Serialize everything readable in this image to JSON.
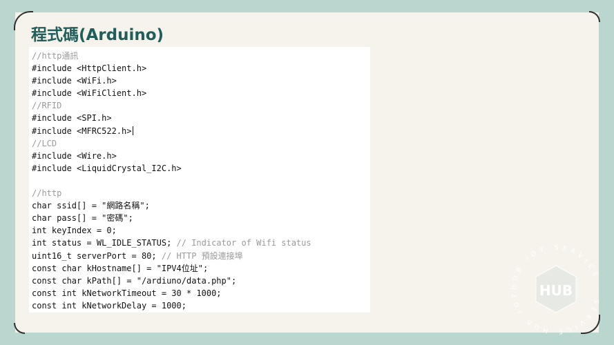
{
  "slide": {
    "title": "程式碼(Arduino)",
    "code": {
      "l1": "//http通訊",
      "l2": "#include <HttpClient.h>",
      "l3": "#include <WiFi.h>",
      "l4": "#include <WiFiClient.h>",
      "l5": "//RFID",
      "l6": "#include <SPI.h>",
      "l7": "#include <MFRC522.h>",
      "l8": "//LCD",
      "l9": "#include <Wire.h>",
      "l10": "#include <LiquidCrystal_I2C.h>",
      "l11": "",
      "l12": "//http",
      "l13": "char ssid[] = \"網路名稱\";",
      "l14": "char pass[] = \"密碼\";",
      "l15": "int keyIndex = 0;",
      "l16_code": "int status = WL_IDLE_STATUS;",
      "l16_comment": " // Indicator of Wifi status",
      "l17_code": "uint16_t serverPort = 80;",
      "l17_comment": " // HTTP 預設連接埠",
      "l18": "const char kHostname[] = \"IPV4位址\";",
      "l19": "const char kPath[] = \"/ardiuno/data.php\";",
      "l20": "const int kNetworkTimeout = 30 * 1000;",
      "l21": "const int kNetworkDelay = 1000;"
    }
  },
  "logo": {
    "ring_text": "HUB IOT SERVICE · SERVICE HUB IOT ·",
    "letters": "HUB",
    "color": "#e6e9e4"
  }
}
